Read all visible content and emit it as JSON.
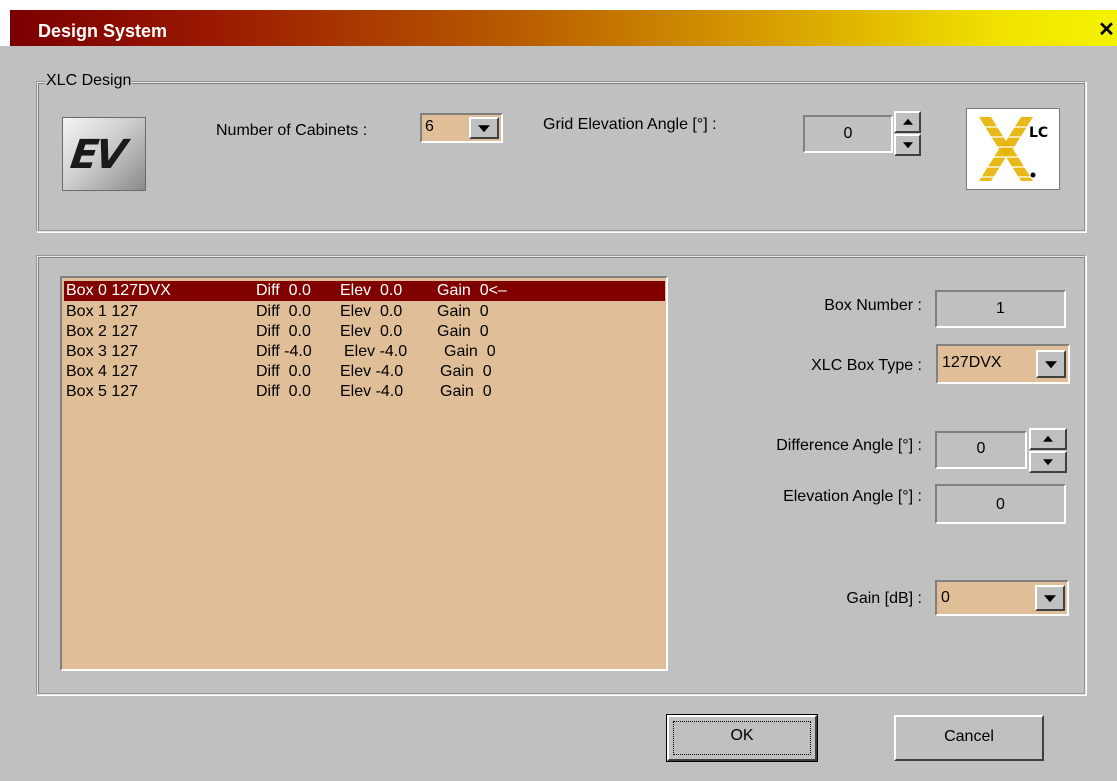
{
  "window": {
    "title": "Design System",
    "close_glyph": "✕"
  },
  "xlc_group": {
    "legend": "XLC Design",
    "ev_logo_text": "EV",
    "xlc_logo_text": "LC",
    "cabinets_label": "Number of Cabinets :",
    "cabinets_value": "6",
    "grid_label": "Grid Elevation Angle [°] :",
    "grid_value": "0"
  },
  "list": {
    "rows": [
      {
        "box": "Box 0 127DVX",
        "diff": "Diff  0.0",
        "elev": "Elev  0.0",
        "gain": "Gain  0<–",
        "selected": true
      },
      {
        "box": "Box 1 127",
        "diff": "Diff  0.0",
        "elev": "Elev  0.0",
        "gain": "Gain  0",
        "selected": false
      },
      {
        "box": "Box 2 127",
        "diff": "Diff  0.0",
        "elev": "Elev  0.0",
        "gain": "Gain  0",
        "selected": false
      },
      {
        "box": "Box 3 127",
        "diff": "Diff -4.0",
        "elev": "Elev -4.0",
        "gain": "Gain  0",
        "selected": false
      },
      {
        "box": "Box 4 127",
        "diff": "Diff  0.0",
        "elev": "Elev -4.0",
        "gain": "Gain  0",
        "selected": false
      },
      {
        "box": "Box 5 127",
        "diff": "Diff  0.0",
        "elev": "Elev -4.0",
        "gain": "Gain  0",
        "selected": false
      }
    ]
  },
  "details": {
    "box_number_label": "Box Number :",
    "box_number_value": "1",
    "box_type_label": "XLC Box Type :",
    "box_type_value": "127DVX",
    "diff_angle_label": "Difference Angle [°] :",
    "diff_angle_value": "0",
    "elev_angle_label": "Elevation Angle [°] :",
    "elev_angle_value": "0",
    "gain_label": "Gain [dB] :",
    "gain_value": "0"
  },
  "buttons": {
    "ok": "OK",
    "cancel": "Cancel"
  },
  "colors": {
    "accent_tan": "#e0bf98",
    "selection": "#800000",
    "title_gradient_start": "#7a0000",
    "title_gradient_end": "#f4f200"
  }
}
